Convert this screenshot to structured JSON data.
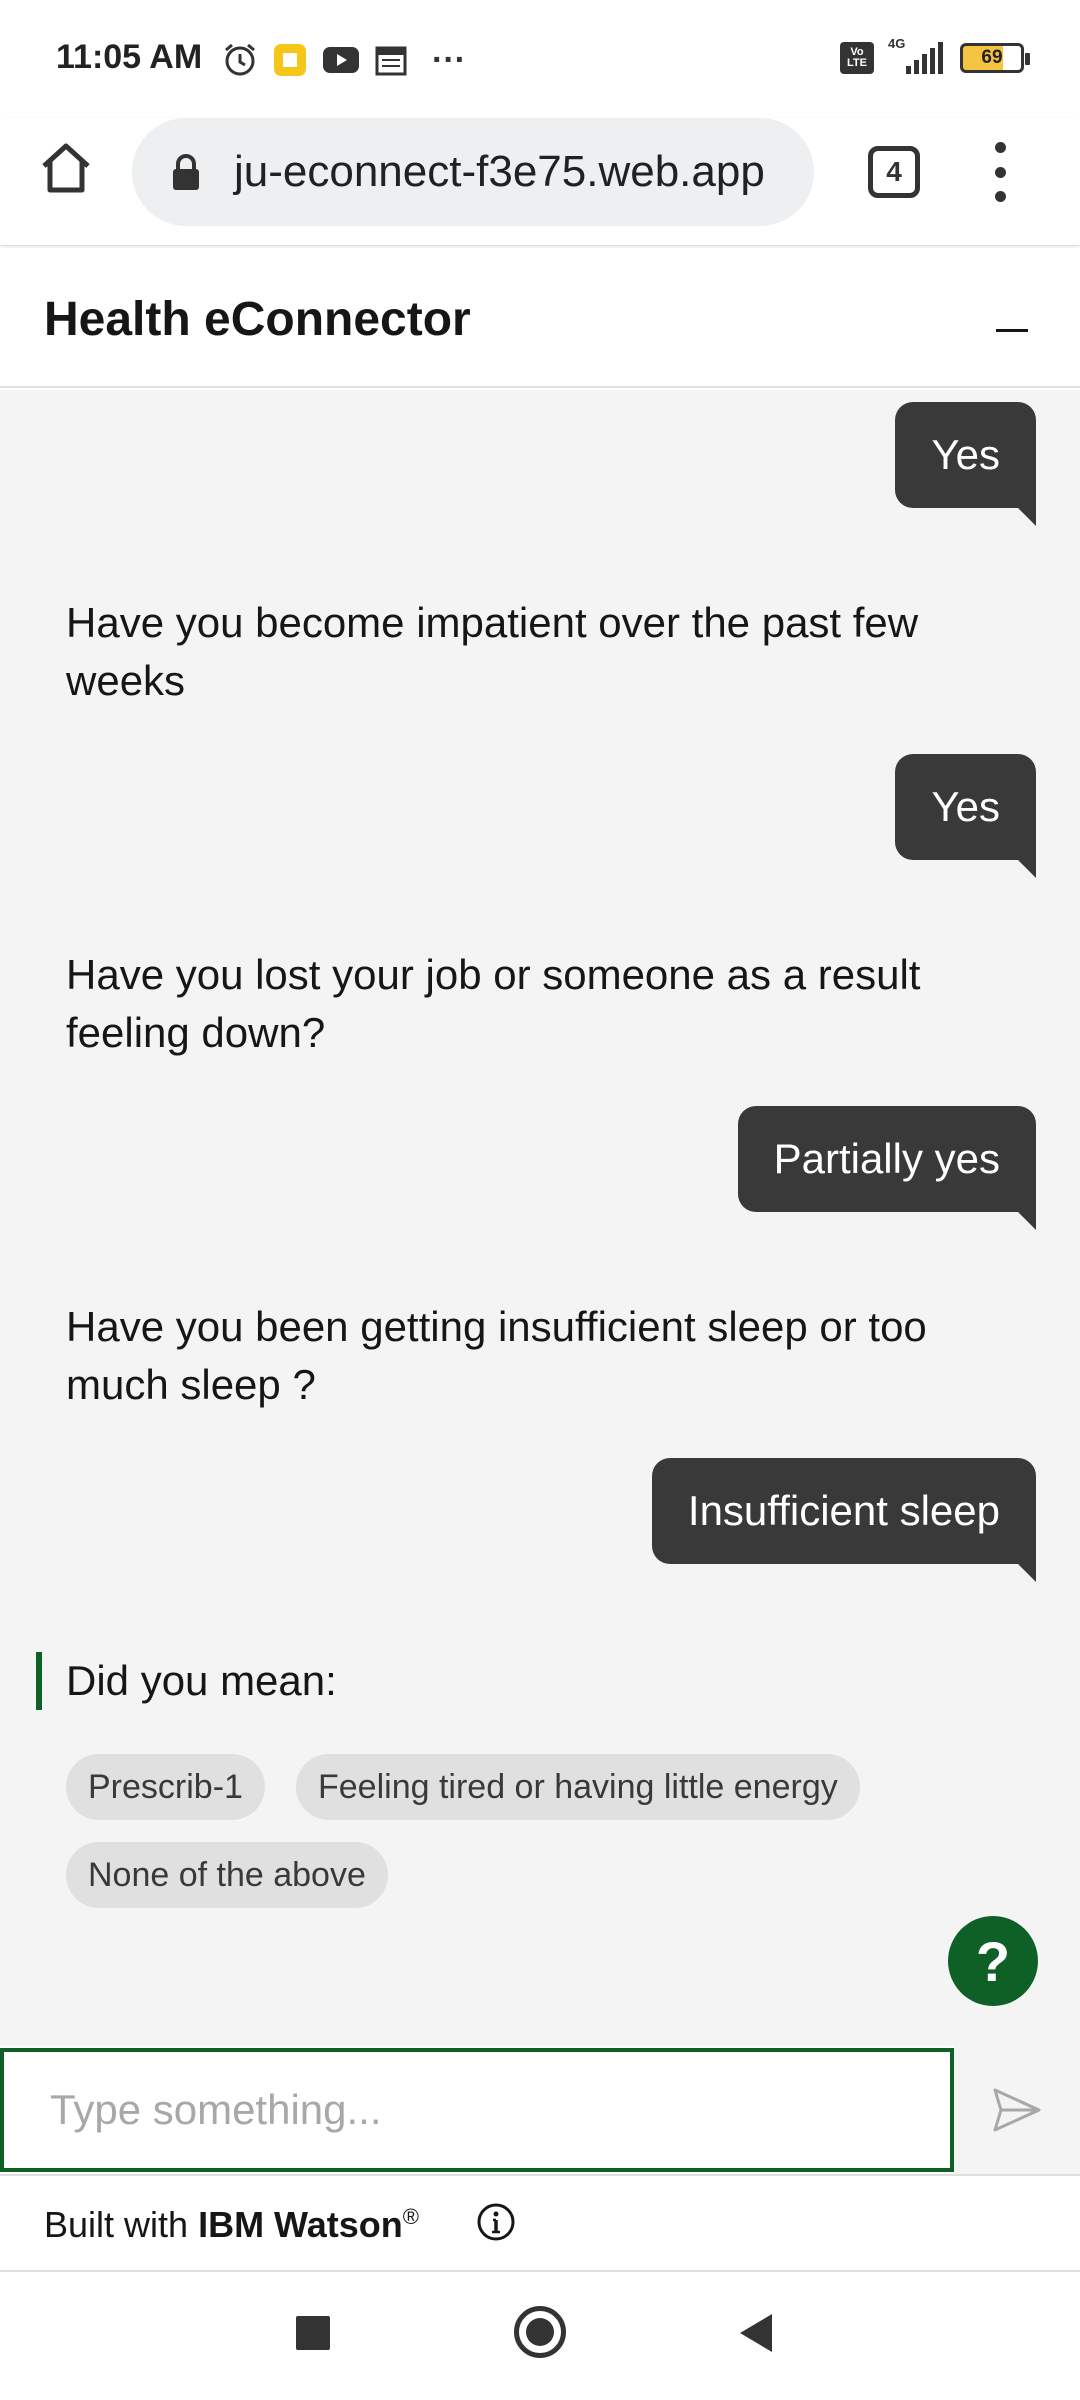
{
  "status_bar": {
    "time": "11:05 AM",
    "icons": [
      "alarm-icon",
      "app-notification-icon",
      "youtube-icon",
      "calendar-icon",
      "more-notifications-icon"
    ],
    "more": "···",
    "network": "4G",
    "volte": "Vo LTE",
    "battery": "69"
  },
  "browser": {
    "url": "ju-econnect-f3e75.web.app",
    "tab_count": "4"
  },
  "chat": {
    "title": "Health eConnector",
    "messages": [
      {
        "from": "user",
        "text": "Yes"
      },
      {
        "from": "bot",
        "text": "Have you become impatient over the past few weeks"
      },
      {
        "from": "user",
        "text": "Yes"
      },
      {
        "from": "bot",
        "text": "Have you lost your job or someone as a result feeling down?"
      },
      {
        "from": "user",
        "text": "Partially yes"
      },
      {
        "from": "bot",
        "text": "Have you been getting insufficient sleep or too much sleep ?"
      },
      {
        "from": "user",
        "text": "Insufficient sleep"
      }
    ],
    "did_you_mean": "Did you mean:",
    "options": [
      "Prescrib-1",
      "Feeling tired or having little energy",
      "None of the above"
    ],
    "help_label": "?",
    "input_placeholder": "Type something..."
  },
  "footer": {
    "built_with": "Built with ",
    "brand": "IBM Watson",
    "trademark": "®"
  },
  "colors": {
    "accent": "#0e6027",
    "user_bubble": "#393939",
    "chat_bg": "#f4f4f4",
    "chip_bg": "#e0e0e0"
  }
}
